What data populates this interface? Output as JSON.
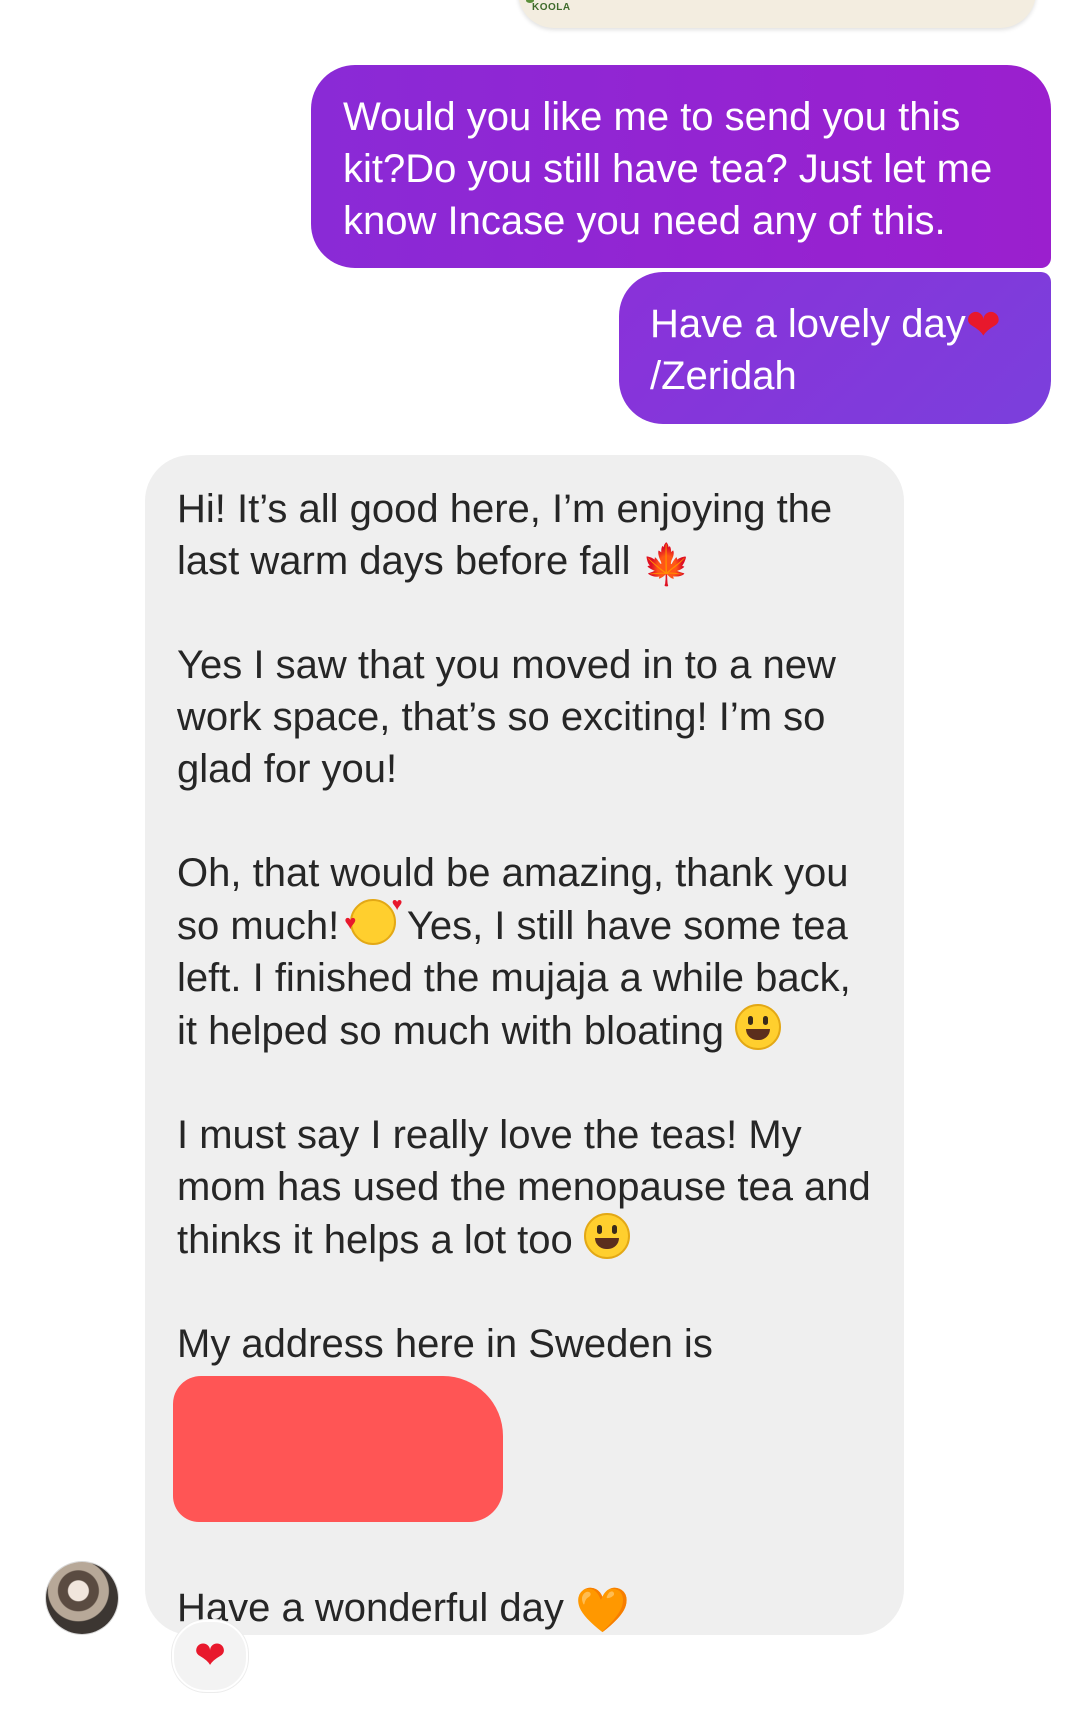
{
  "attachment": {
    "logo_text": "KOOLA"
  },
  "messages_out": [
    {
      "text": "Would you like me to send you this kit?Do you still have tea? Just let me know Incase you need any of this."
    },
    {
      "line1": "Have a lovely day",
      "heart": "❤",
      "line2": "/Zeridah"
    }
  ],
  "message_in": {
    "p1_text": "Hi! It’s all good here, I’m enjoying the last warm days before fall",
    "p1_emoji": "🍁",
    "p2_text": "Yes I saw that you moved in to a new work space, that’s so exciting! I’m so glad for you!",
    "p3_a": "Oh, that would be amazing, thank you so much!",
    "p3_b": "Yes, I still have some tea left. I finished the mujaja a while back, it helped so much with bloating",
    "p4_text": "I must say I really love the teas! My mom has used the menopause tea and thinks it helps a lot too",
    "p5_text": "My address here in Sweden is",
    "p6_text": "Have a wonderful day",
    "p6_emoji": "🧡"
  },
  "reaction": {
    "emoji": "❤"
  },
  "colors": {
    "out_bubble": "#8a2ad6",
    "in_bubble": "#efefef",
    "redaction": "#ff5555"
  }
}
